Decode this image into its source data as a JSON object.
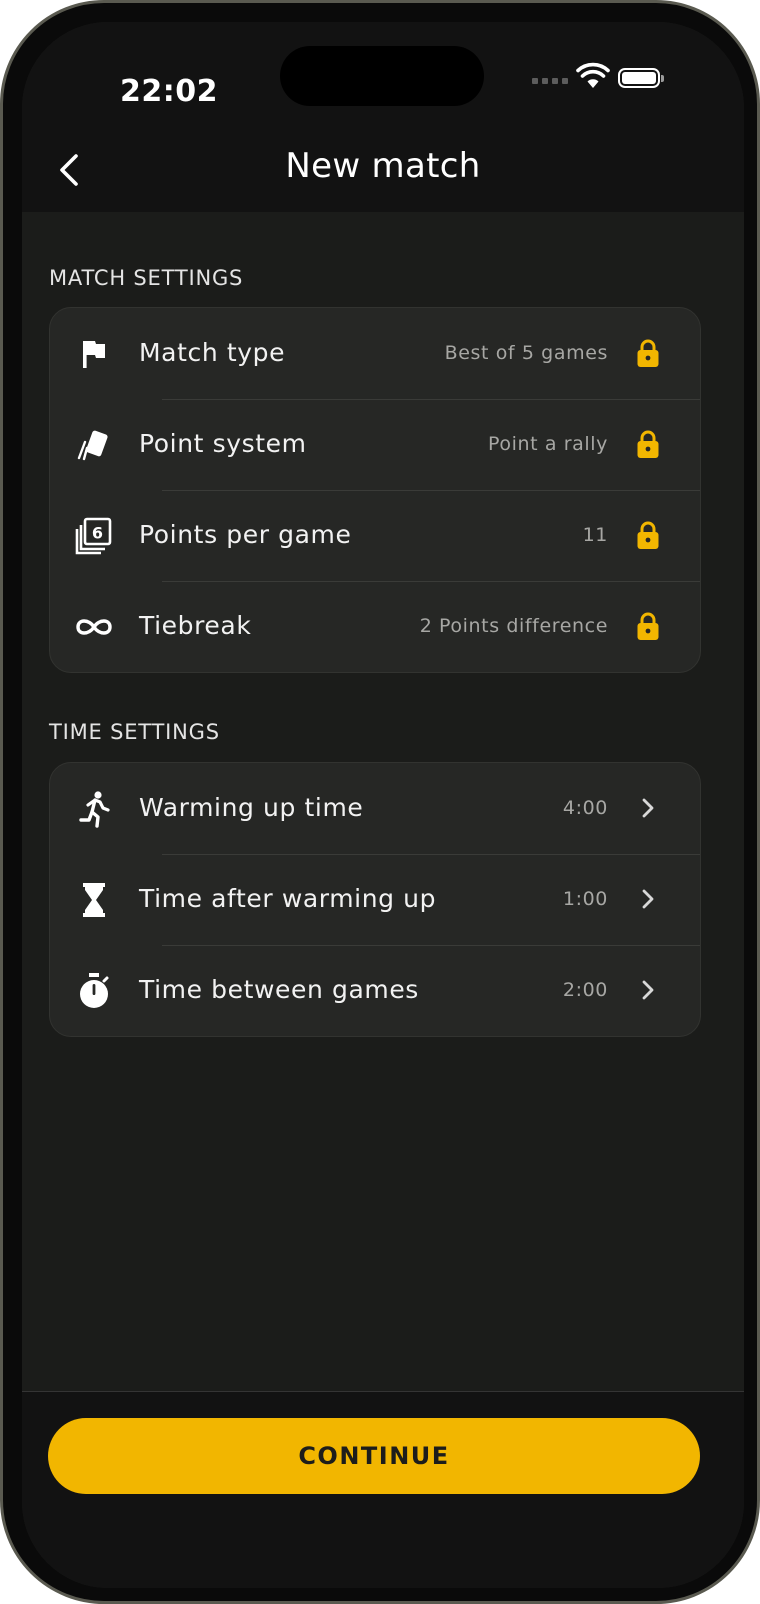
{
  "status_bar": {
    "time": "22:02"
  },
  "nav": {
    "title": "New match"
  },
  "colors": {
    "accent": "#f2b600",
    "background": "#1b1c1a",
    "card": "#262725"
  },
  "match_settings": {
    "section_label": "MATCH SETTINGS",
    "items": [
      {
        "label": "Match type",
        "value": "Best of 5 games",
        "icon": "flag-icon",
        "trailing": "lock-icon"
      },
      {
        "label": "Point system",
        "value": "Point a rally",
        "icon": "cards-icon",
        "trailing": "lock-icon"
      },
      {
        "label": "Points per game",
        "value": "11",
        "icon": "number-six-icon",
        "trailing": "lock-icon"
      },
      {
        "label": "Tiebreak",
        "value": "2 Points difference",
        "icon": "infinity-icon",
        "trailing": "lock-icon"
      }
    ]
  },
  "time_settings": {
    "section_label": "TIME SETTINGS",
    "items": [
      {
        "label": "Warming up time",
        "value": "4:00",
        "icon": "running-person-icon",
        "trailing": "chevron-right-icon"
      },
      {
        "label": "Time after warming up",
        "value": "1:00",
        "icon": "hourglass-icon",
        "trailing": "chevron-right-icon"
      },
      {
        "label": "Time between games",
        "value": "2:00",
        "icon": "stopwatch-icon",
        "trailing": "chevron-right-icon"
      }
    ]
  },
  "footer": {
    "continue_label": "CONTINUE"
  }
}
